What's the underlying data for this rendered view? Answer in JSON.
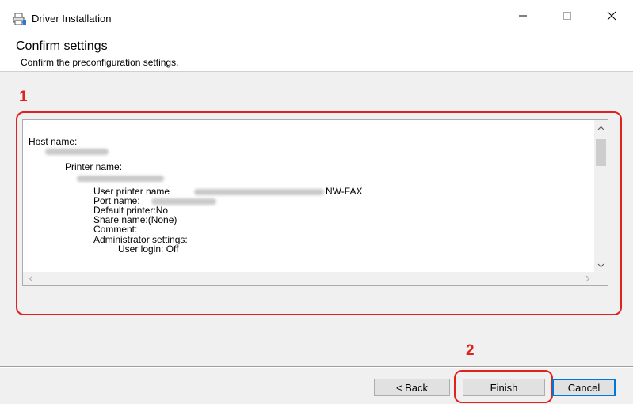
{
  "window": {
    "title": "Driver Installation",
    "controls": {
      "minimize_icon": "minimize-icon",
      "maximize_icon": "maximize-icon",
      "close_icon": "close-icon"
    }
  },
  "header": {
    "title": "Confirm settings",
    "subtitle": "Confirm the preconfiguration settings."
  },
  "annotations": {
    "label_1": "1",
    "label_2": "2",
    "color": "#e0221f"
  },
  "settings_box": {
    "lines": [
      "Host name:",
      "Printer name:",
      "User printer name",
      "NW-FAX",
      "Port name:",
      "Default printer:No",
      "Share name:(None)",
      "Comment:",
      "Administrator settings:",
      "User login: Off"
    ],
    "scroll_icons": {
      "up": "scroll-up-arrow-icon",
      "down": "scroll-down-arrow-icon",
      "left": "scroll-left-arrow-icon",
      "right": "scroll-right-arrow-icon"
    }
  },
  "buttons": {
    "back": "< Back",
    "finish": "Finish",
    "cancel": "Cancel",
    "focus_color": "#0078d7"
  }
}
